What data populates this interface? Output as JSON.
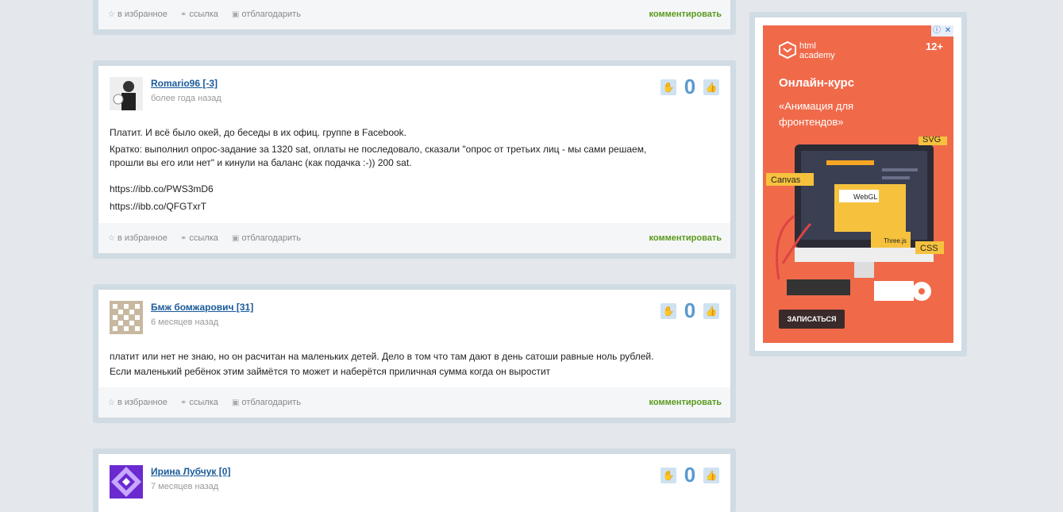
{
  "footer_labels": {
    "favorite": "в избранное",
    "link": "ссылка",
    "thank": "отблагодарить",
    "comment": "комментировать"
  },
  "posts": [
    {
      "user": "Romario96 [-3]",
      "time": "более года назад",
      "votes": "0",
      "lines": [
        "Платит. И всё было окей, до беседы в их офиц. группе в Facebook.",
        "Кратко: выполнил опрос-задание за 1320 sat, оплаты не последовало, сказали \"опрос от третьих лиц - мы сами решаем,",
        "прошли вы его или нет\" и кинули на баланс (как подачка :-)) 200 sat.",
        "https://ibb.co/PWS3mD6",
        "https://ibb.co/QFGTxrT"
      ]
    },
    {
      "user": "Бмж бомжарович [31]",
      "time": "6 месяцев назад",
      "votes": "0",
      "lines": [
        "платит или нет не знаю, но он расчитан на маленьких детей. Дело в том что там дают в день сатоши равные ноль рублей.",
        "Если маленький ребёнок этим займётся то может и наберётся приличная сумма когда он выростит"
      ]
    },
    {
      "user": "Ирина Лубчук [0]",
      "time": "7 месяцев назад",
      "votes": "0"
    }
  ],
  "ad": {
    "logo": "html academy",
    "age": "12+",
    "title": "Онлайн-курс",
    "subtitle": "«Анимация для фронтендов»",
    "tags": [
      "SVG",
      "Canvas",
      "WebGL",
      "CSS",
      "Three.js"
    ],
    "cta": "ЗАПИСАТЬСЯ"
  },
  "colors": {
    "accent_green": "#5a9a1c",
    "link_blue": "#1a5a9a",
    "ad_bg": "#f06a4a"
  }
}
